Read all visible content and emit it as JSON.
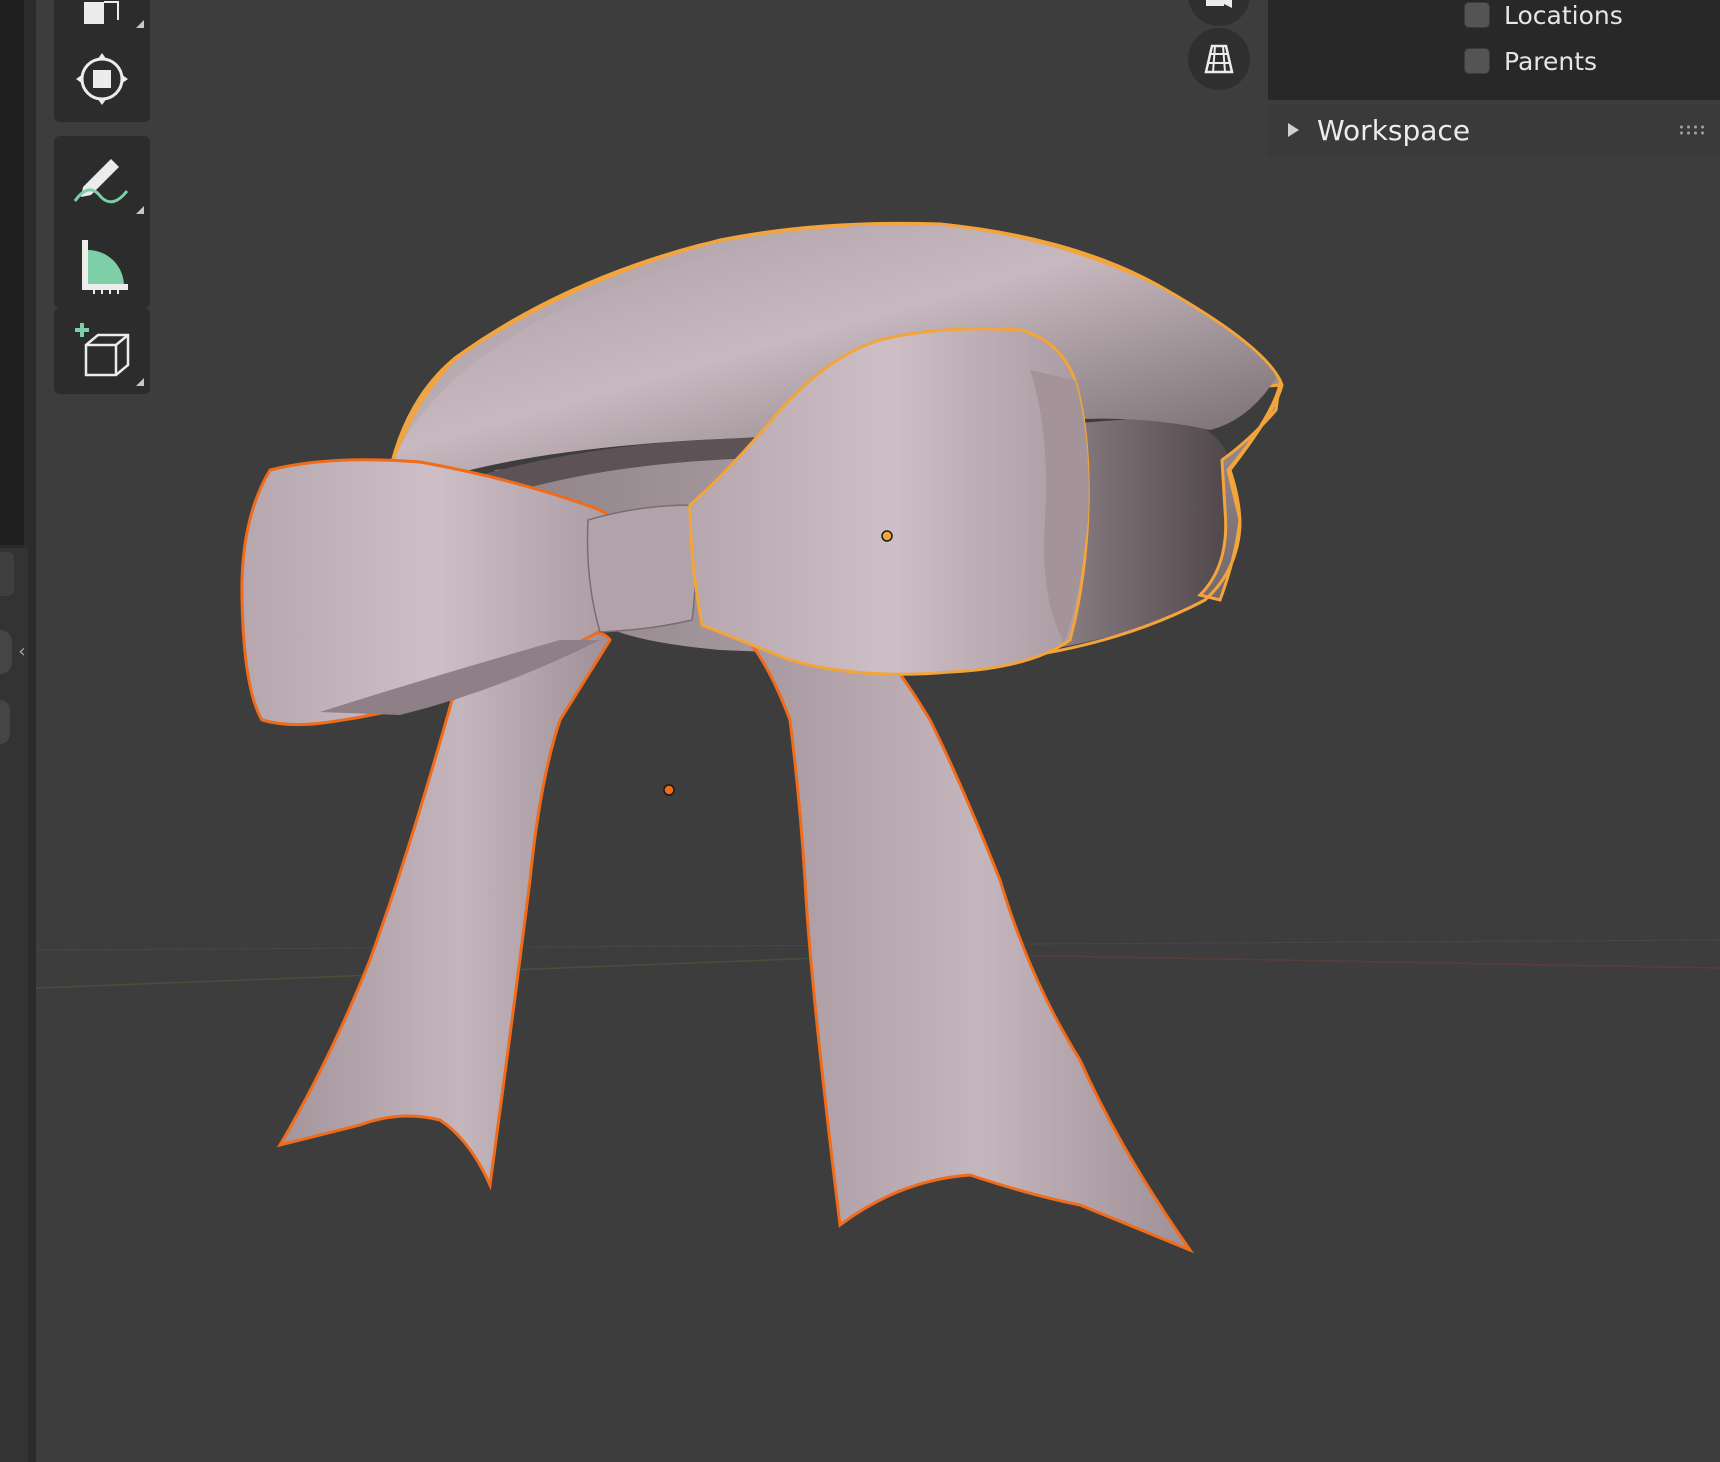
{
  "overlay_options": {
    "items": [
      {
        "label": "Locations",
        "checked": false
      },
      {
        "label": "Parents",
        "checked": false
      }
    ]
  },
  "panels": [
    {
      "label": "Workspace",
      "expanded": false
    }
  ],
  "toolbar": {
    "tools": [
      "scale-icon",
      "transform-icon",
      "annotate-icon",
      "measure-icon",
      "add-cube-icon"
    ]
  },
  "colors": {
    "viewport_bg": "#3d3d3d",
    "selection_outline": "#f08a24",
    "active_outline": "#f0a030",
    "mesh": "#b9a9af",
    "accent_green": "#7ecfa8"
  }
}
